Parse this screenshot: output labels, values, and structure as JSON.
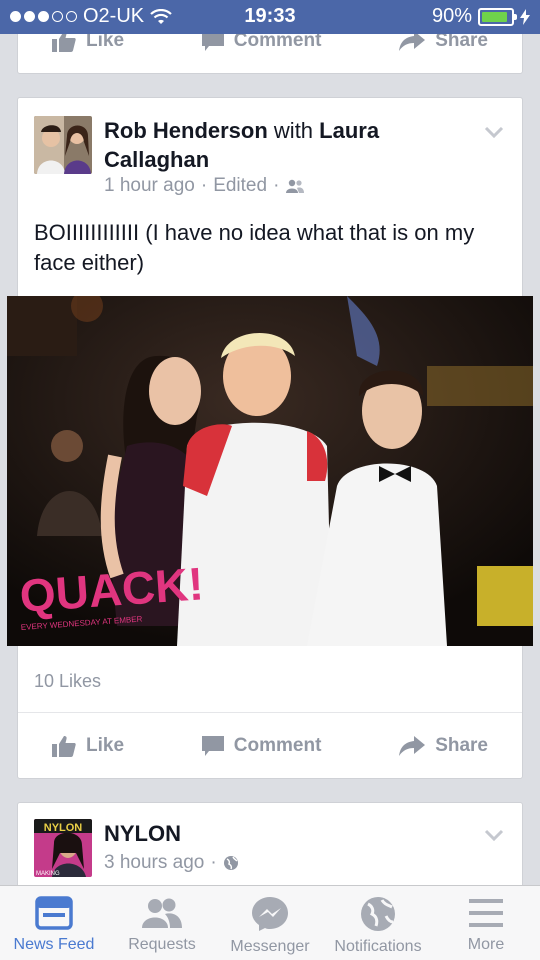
{
  "status_bar": {
    "signal_bars": 3,
    "carrier": "O2-UK",
    "time": "19:33",
    "battery": "90%",
    "battery_level": 0.9
  },
  "top_card": {
    "like": "Like",
    "comment": "Comment",
    "share": "Share"
  },
  "post1": {
    "author": "Rob Henderson",
    "with_word": "with",
    "tagged": "Laura Callaghan",
    "time": "1 hour ago",
    "edited": "Edited",
    "audience_icon": "friends-icon",
    "text": "BOIIIIIIIIIIII (I have no idea what that is on my face either)",
    "photo_caption": "QUACK!",
    "photo_subcaption": "EVERY WEDNESDAY AT EMBER",
    "likes": "10 Likes",
    "like": "Like",
    "comment": "Comment",
    "share": "Share"
  },
  "post2": {
    "author": "NYLON",
    "time": "3 hours ago",
    "audience_icon": "globe-icon",
    "avatar_masthead": "NYLON",
    "avatar_cover_text": "MAKING"
  },
  "tab_bar": [
    {
      "label": "News Feed",
      "icon": "news-feed-icon",
      "active": true
    },
    {
      "label": "Requests",
      "icon": "requests-icon",
      "active": false
    },
    {
      "label": "Messenger",
      "icon": "messenger-icon",
      "active": false
    },
    {
      "label": "Notifications",
      "icon": "globe-icon",
      "active": false
    },
    {
      "label": "More",
      "icon": "menu-icon",
      "active": false
    }
  ],
  "colors": {
    "facebook_blue": "#4b67a8",
    "active_tab": "#4a7ad0",
    "muted": "#9197a3",
    "quack_pink": "#e0357f"
  }
}
